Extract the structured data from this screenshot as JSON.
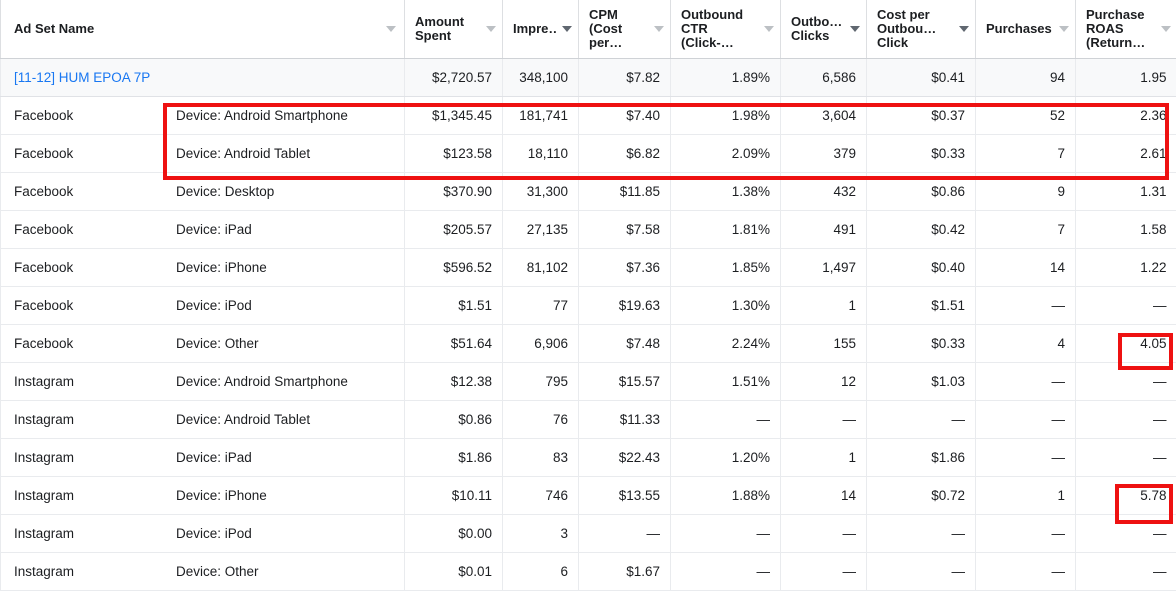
{
  "table": {
    "columns": [
      {
        "label": "Ad Set Name",
        "caret": "chevron-down-icon",
        "align": "left"
      },
      {
        "label": "Amount\nSpent",
        "caret": "chevron-down-icon",
        "align": "right"
      },
      {
        "label": "Impre…",
        "caret": "chevron-down-icon",
        "align": "right"
      },
      {
        "label": "CPM\n(Cost\nper…",
        "caret": "chevron-down-icon",
        "align": "right"
      },
      {
        "label": "Outbound\nCTR\n(Click-…",
        "caret": "chevron-down-icon",
        "align": "right"
      },
      {
        "label": "Outbo…\nClicks",
        "caret": "chevron-down-icon",
        "align": "right"
      },
      {
        "label": "Cost per\nOutbou…\nClick",
        "caret": "chevron-down-icon",
        "align": "right"
      },
      {
        "label": "Purchases",
        "caret": "chevron-down-icon",
        "align": "right"
      },
      {
        "label": "Purchase\nROAS\n(Return…",
        "caret": "chevron-down-icon",
        "align": "right"
      }
    ],
    "summary_row": {
      "name": "[11-12] HUM EPOA 7P",
      "amount_spent": "$2,720.57",
      "impressions": "348,100",
      "cpm": "$7.82",
      "outbound_ctr": "1.89%",
      "outbound_clicks": "6,586",
      "cost_per_outbound_click": "$0.41",
      "purchases": "94",
      "purchase_roas": "1.95"
    },
    "rows": [
      {
        "platform": "Facebook",
        "device": "Device: Android Smartphone",
        "amount_spent": "$1,345.45",
        "impressions": "181,741",
        "cpm": "$7.40",
        "outbound_ctr": "1.98%",
        "outbound_clicks": "3,604",
        "cost_per_outbound_click": "$0.37",
        "purchases": "52",
        "purchase_roas": "2.36"
      },
      {
        "platform": "Facebook",
        "device": "Device: Android Tablet",
        "amount_spent": "$123.58",
        "impressions": "18,110",
        "cpm": "$6.82",
        "outbound_ctr": "2.09%",
        "outbound_clicks": "379",
        "cost_per_outbound_click": "$0.33",
        "purchases": "7",
        "purchase_roas": "2.61"
      },
      {
        "platform": "Facebook",
        "device": "Device: Desktop",
        "amount_spent": "$370.90",
        "impressions": "31,300",
        "cpm": "$11.85",
        "outbound_ctr": "1.38%",
        "outbound_clicks": "432",
        "cost_per_outbound_click": "$0.86",
        "purchases": "9",
        "purchase_roas": "1.31"
      },
      {
        "platform": "Facebook",
        "device": "Device: iPad",
        "amount_spent": "$205.57",
        "impressions": "27,135",
        "cpm": "$7.58",
        "outbound_ctr": "1.81%",
        "outbound_clicks": "491",
        "cost_per_outbound_click": "$0.42",
        "purchases": "7",
        "purchase_roas": "1.58"
      },
      {
        "platform": "Facebook",
        "device": "Device: iPhone",
        "amount_spent": "$596.52",
        "impressions": "81,102",
        "cpm": "$7.36",
        "outbound_ctr": "1.85%",
        "outbound_clicks": "1,497",
        "cost_per_outbound_click": "$0.40",
        "purchases": "14",
        "purchase_roas": "1.22"
      },
      {
        "platform": "Facebook",
        "device": "Device: iPod",
        "amount_spent": "$1.51",
        "impressions": "77",
        "cpm": "$19.63",
        "outbound_ctr": "1.30%",
        "outbound_clicks": "1",
        "cost_per_outbound_click": "$1.51",
        "purchases": "—",
        "purchase_roas": "—"
      },
      {
        "platform": "Facebook",
        "device": "Device: Other",
        "amount_spent": "$51.64",
        "impressions": "6,906",
        "cpm": "$7.48",
        "outbound_ctr": "2.24%",
        "outbound_clicks": "155",
        "cost_per_outbound_click": "$0.33",
        "purchases": "4",
        "purchase_roas": "4.05"
      },
      {
        "platform": "Instagram",
        "device": "Device: Android Smartphone",
        "amount_spent": "$12.38",
        "impressions": "795",
        "cpm": "$15.57",
        "outbound_ctr": "1.51%",
        "outbound_clicks": "12",
        "cost_per_outbound_click": "$1.03",
        "purchases": "—",
        "purchase_roas": "—"
      },
      {
        "platform": "Instagram",
        "device": "Device: Android Tablet",
        "amount_spent": "$0.86",
        "impressions": "76",
        "cpm": "$11.33",
        "outbound_ctr": "—",
        "outbound_clicks": "—",
        "cost_per_outbound_click": "—",
        "purchases": "—",
        "purchase_roas": "—"
      },
      {
        "platform": "Instagram",
        "device": "Device: iPad",
        "amount_spent": "$1.86",
        "impressions": "83",
        "cpm": "$22.43",
        "outbound_ctr": "1.20%",
        "outbound_clicks": "1",
        "cost_per_outbound_click": "$1.86",
        "purchases": "—",
        "purchase_roas": "—"
      },
      {
        "platform": "Instagram",
        "device": "Device: iPhone",
        "amount_spent": "$10.11",
        "impressions": "746",
        "cpm": "$13.55",
        "outbound_ctr": "1.88%",
        "outbound_clicks": "14",
        "cost_per_outbound_click": "$0.72",
        "purchases": "1",
        "purchase_roas": "5.78"
      },
      {
        "platform": "Instagram",
        "device": "Device: iPod",
        "amount_spent": "$0.00",
        "impressions": "3",
        "cpm": "—",
        "outbound_ctr": "—",
        "outbound_clicks": "—",
        "cost_per_outbound_click": "—",
        "purchases": "—",
        "purchase_roas": "—"
      },
      {
        "platform": "Instagram",
        "device": "Device: Other",
        "amount_spent": "$0.01",
        "impressions": "6",
        "cpm": "$1.67",
        "outbound_ctr": "—",
        "outbound_clicks": "—",
        "cost_per_outbound_click": "—",
        "purchases": "—",
        "purchase_roas": "—"
      }
    ]
  },
  "annotations": {
    "highlight_color": "#ee1111",
    "boxes": [
      {
        "name": "android-device-rows-highlight"
      },
      {
        "name": "purchase-roas-405-highlight"
      },
      {
        "name": "purchase-roas-578-highlight"
      }
    ]
  },
  "colors": {
    "link": "#1877f2",
    "summary_row_background": "#f8f9fa",
    "grid_line": "#e9ebee"
  }
}
